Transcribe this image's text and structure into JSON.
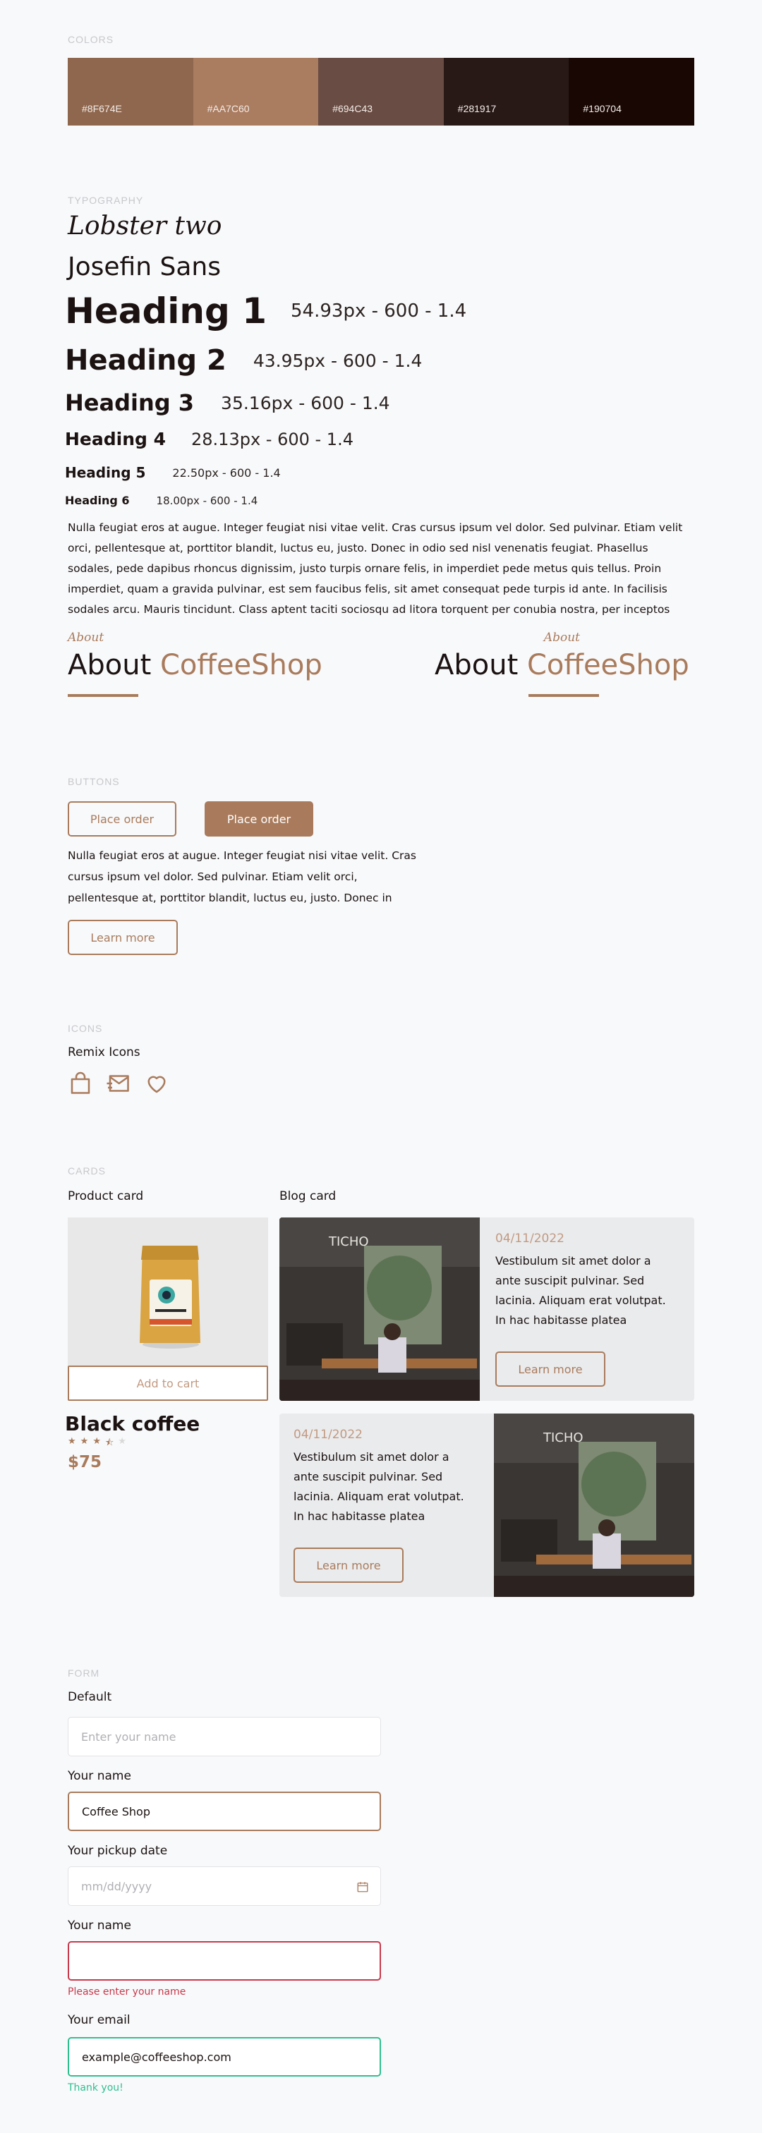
{
  "sections": {
    "colors": "COLORS",
    "typography": "TYPOGRAPHY",
    "buttons": "BUTTONS",
    "icons": "ICONS",
    "cards": "CARDS",
    "form": "FORM"
  },
  "colors": [
    {
      "label": "#8F674E",
      "hex": "#8F674E"
    },
    {
      "label": "#AA7C60",
      "hex": "#AA7C60"
    },
    {
      "label": "#694C43",
      "hex": "#694C43"
    },
    {
      "label": "#281917",
      "hex": "#281917"
    },
    {
      "label": "#190704",
      "hex": "#190704"
    }
  ],
  "typography": {
    "script_font": "Lobster two",
    "sans_font": "Josefin Sans",
    "headings": [
      {
        "name": "Heading 1",
        "spec": "54.93px - 600 - 1.4"
      },
      {
        "name": "Heading 2",
        "spec": "43.95px - 600 - 1.4"
      },
      {
        "name": "Heading 3",
        "spec": "35.16px - 600 - 1.4"
      },
      {
        "name": "Heading 4",
        "spec": "28.13px - 600 - 1.4"
      },
      {
        "name": "Heading 5",
        "spec": "22.50px - 600 - 1.4"
      },
      {
        "name": "Heading 6",
        "spec": "18.00px - 600 - 1.4"
      }
    ],
    "paragraph": "Nulla feugiat eros at augue. Integer feugiat nisi vitae velit. Cras cursus ipsum vel dolor. Sed pulvinar. Etiam velit orci, pellentesque at, porttitor blandit, luctus eu, justo. Donec in odio sed nisl venenatis feugiat. Phasellus sodales, pede dapibus rhoncus dignissim, justo turpis ornare felis, in imperdiet pede metus quis tellus. Proin imperdiet, quam a gravida pulvinar, est sem faucibus felis, sit amet consequat pede turpis id ante. In facilisis sodales arcu. Mauris tincidunt. Class aptent taciti sociosqu ad litora torquent per conubia nostra, per inceptos",
    "about_small": "About",
    "about_word": "About",
    "about_accent": "CoffeeShop"
  },
  "buttons": {
    "outline_label": "Place order",
    "filled_label": "Place order",
    "paragraph": "Nulla feugiat eros at augue. Integer feugiat nisi vitae velit. Cras cursus ipsum vel dolor. Sed pulvinar. Etiam velit orci, pellentesque at, porttitor blandit, luctus eu, justo. Donec in",
    "learn_more": "Learn more"
  },
  "icons": {
    "title": "Remix Icons",
    "items": [
      "shopping-bag-icon",
      "mail-send-icon",
      "heart-icon"
    ]
  },
  "cards": {
    "product_label": "Product card",
    "blog_label": "Blog card",
    "product": {
      "add_to_cart": "Add to cart",
      "name": "Black coffee",
      "rating": 3.5,
      "rating_max": 5,
      "price": "$75"
    },
    "blog": [
      {
        "date": "04/11/2022",
        "text": "Vestibulum sit amet dolor a ante suscipit pulvinar. Sed lacinia. Aliquam erat volutpat. In hac habitasse platea",
        "button": "Learn more"
      },
      {
        "date": "04/11/2022",
        "text": "Vestibulum sit amet dolor a ante suscipit pulvinar. Sed lacinia. Aliquam erat volutpat. In hac habitasse platea",
        "button": "Learn more"
      }
    ]
  },
  "form": {
    "default_label": "Default",
    "default_placeholder": "Enter your name",
    "name_label": "Your name",
    "name_value": "Coffee Shop",
    "date_label": "Your pickup date",
    "date_placeholder": "mm/dd/yyyy",
    "error_label": "Your name",
    "error_message": "Please enter your name",
    "email_label": "Your email",
    "email_value": "example@coffeeshop.com",
    "success_message": "Thank you!",
    "accent": "#a97b5c",
    "error_color": "#c8394b",
    "success_color": "#2fbf8f"
  }
}
